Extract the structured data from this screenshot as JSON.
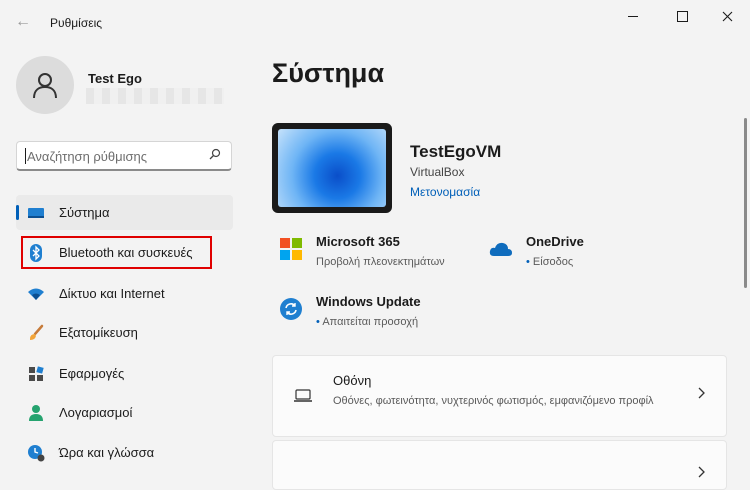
{
  "window": {
    "title": "Ρυθμίσεις"
  },
  "profile": {
    "name": "Test Ego"
  },
  "search": {
    "placeholder": "Αναζήτηση ρύθμισης"
  },
  "sidebar": {
    "items": [
      {
        "label": "Σύστημα",
        "icon": "system-icon"
      },
      {
        "label": "Bluetooth και συσκευές",
        "icon": "bluetooth-icon"
      },
      {
        "label": "Δίκτυο και Internet",
        "icon": "wifi-icon"
      },
      {
        "label": "Εξατομίκευση",
        "icon": "brush-icon"
      },
      {
        "label": "Εφαρμογές",
        "icon": "apps-icon"
      },
      {
        "label": "Λογαριασμοί",
        "icon": "person-icon"
      },
      {
        "label": "Ώρα και γλώσσα",
        "icon": "time-language-icon"
      }
    ],
    "active_index": 0,
    "highlighted_index": 1
  },
  "main": {
    "title": "Σύστημα",
    "device": {
      "name": "TestEgoVM",
      "model": "VirtualBox",
      "rename_label": "Μετονομασία"
    },
    "tiles": [
      {
        "title": "Microsoft 365",
        "subtitle": "Προβολή πλεονεκτημάτων",
        "icon": "microsoft-365-icon"
      },
      {
        "title": "OneDrive",
        "subtitle": "Είσοδος",
        "icon": "onedrive-icon",
        "bullet": "•"
      },
      {
        "title": "Windows Update",
        "subtitle": "Απαιτείται προσοχή",
        "icon": "windows-update-icon",
        "bullet": "•"
      }
    ],
    "cards": [
      {
        "title": "Οθόνη",
        "description": "Οθόνες, φωτεινότητα, νυχτερινός φωτισμός, εμφανιζόμενο προφίλ",
        "icon": "display-icon"
      }
    ]
  },
  "colors": {
    "accent": "#005fb8",
    "highlight_border": "#e00000"
  }
}
